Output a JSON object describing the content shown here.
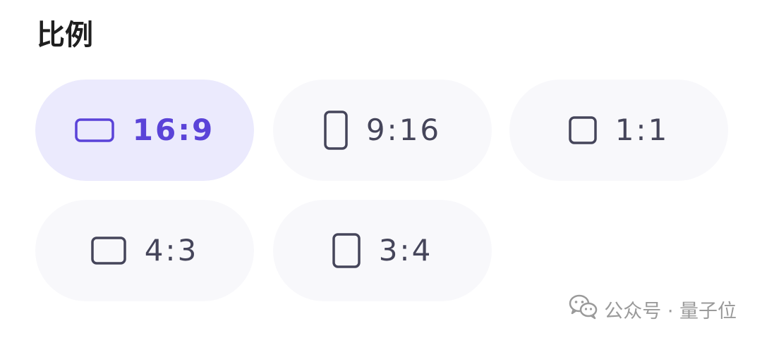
{
  "section": {
    "title": "比例"
  },
  "ratio_options": [
    {
      "label": "16:9",
      "icon": "landscape-wide-icon",
      "selected": true
    },
    {
      "label": "9:16",
      "icon": "portrait-tall-icon",
      "selected": false
    },
    {
      "label": "1:1",
      "icon": "square-icon",
      "selected": false
    },
    {
      "label": "4:3",
      "icon": "landscape-icon",
      "selected": false
    },
    {
      "label": "3:4",
      "icon": "portrait-icon",
      "selected": false
    }
  ],
  "watermark": {
    "icon": "wechat-icon",
    "text": "公众号 · 量子位"
  },
  "colors": {
    "selected_background": "#ebeafd",
    "selected_foreground": "#5a43d8",
    "option_background": "#f8f8fb",
    "option_foreground": "#45455a",
    "title": "#1f1f1f",
    "watermark": "#9a9a9a"
  }
}
